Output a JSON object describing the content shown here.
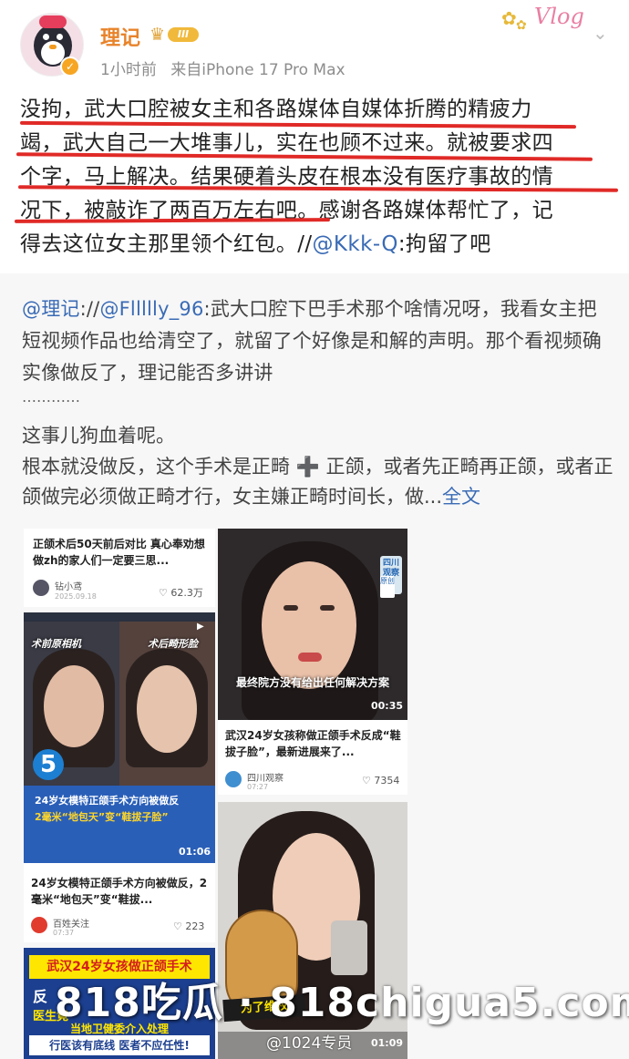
{
  "header": {
    "author": "理记",
    "level": "III",
    "time": "1小时前",
    "source": "来自iPhone 17 Pro Max",
    "vlog_badge": "Vlog",
    "more_icon": "chevron-down-icon"
  },
  "post": {
    "lines": [
      "没拘，武大口腔被女主和各路媒体自媒体折腾的精疲力",
      "竭，武大自己一大堆事儿，实在也顾不过来。就被要求四",
      "个字，马上解决。结果硬着头皮在根本没有医疗事故的情",
      "况下，被敲诈了两百万左右吧。感谢各路媒体帮忙了，记",
      "得去这位女主那里领个红包。//"
    ],
    "mention": "@Kkk-Q",
    "tail": ":拘留了吧"
  },
  "quote": {
    "mention_author": "@理记",
    "sep": "://",
    "mention_user": "@Fllllly_96",
    "text": ":武大口腔下巴手术那个啥情况呀，我看女主把短视频作品也给清空了，就留了个好像是和解的声明。那个看视频确实像做反了，理记能否多讲讲",
    "dots": "…………",
    "reply1": "这事儿狗血着呢。",
    "reply2": "根本就没做反，这个手术是正畸 ➕ 正颌，或者先正畸再正颌，或者正颌做完必须做正畸才行，女主嫌正畸时间长，做...",
    "more": "全文"
  },
  "cards": {
    "c1": {
      "title": "正颌术后50天前后对比 真心奉劝想做zh的家人们一定要三思...",
      "author": "钻小鸢",
      "date": "2025.09.18",
      "likes": "62.3万"
    },
    "c2": {
      "title": "武汉24岁女孩称做正颌手术反成“鞋拔子脸”，最新进展来了...",
      "author": "四川观察",
      "date": "07:27",
      "likes": "7354",
      "overlay": "最终院方没有给出任何解决方案",
      "duration": "00:35",
      "logo": "四川\n观察",
      "badge": "原创"
    },
    "c3": {
      "title": "24岁女模特正颌手术方向被做反，2毫米“地包天”变“鞋拔...",
      "author": "百姓关注",
      "date": "07:37",
      "likes": "223",
      "label_left": "术前原相机",
      "label_right": "术后畸形脸",
      "cap1": "24岁女模特正颌手术方向被做反",
      "cap2": "2毫米“地包天”变“鞋拔子脸”",
      "duration": "01:06"
    },
    "c4": {
      "line1": "武汉24岁女孩做正颌手术",
      "line2": "反",
      "line3": "医生竟",
      "line4": "当地卫健委介入处理",
      "line5": "行医该有底线 医者不应任性!",
      "green": "医生"
    },
    "c5": {
      "sticker": "为了维权",
      "user": "@1024专员",
      "duration": "01:09"
    }
  },
  "watermark": "818吃瓜 · 818chigua5.com",
  "colors": {
    "accent": "#e8832a",
    "link": "#3a6bb5",
    "underline": "#e02a27",
    "quote_bg": "#f7f7f7"
  }
}
